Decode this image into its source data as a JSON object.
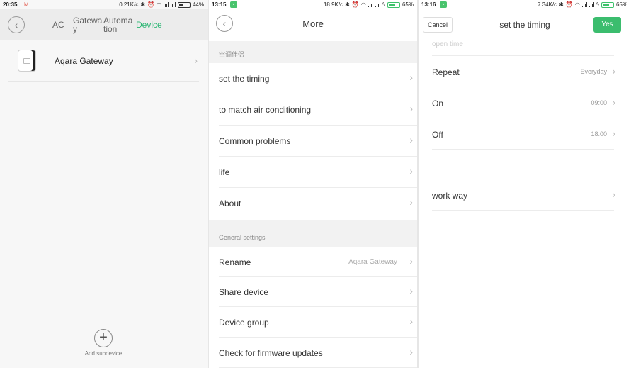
{
  "panel1": {
    "status": {
      "time": "20:35",
      "speed": "0.21K/c",
      "battery": "44%",
      "battery_level": 0.44
    },
    "tabs": [
      "AC",
      "Gatewa\ny",
      "Automa\ntion",
      "Device"
    ],
    "device": {
      "name": "Aqara Gateway"
    },
    "add_subdevice": "Add subdevice"
  },
  "panel2": {
    "status": {
      "time": "13:15",
      "speed": "18.9K/c",
      "battery": "65%",
      "battery_level": 0.65
    },
    "title": "More",
    "section1": "空调伴侣",
    "items1": [
      "set the timing",
      "to match air conditioning",
      "Common problems",
      "life",
      "About"
    ],
    "section2": "General settings",
    "items2": [
      {
        "label": "Rename",
        "value": "Aqara Gateway"
      },
      {
        "label": "Share device",
        "value": ""
      },
      {
        "label": "Device group",
        "value": ""
      },
      {
        "label": "Check for firmware updates",
        "value": ""
      }
    ]
  },
  "panel3": {
    "status": {
      "time": "13:16",
      "speed": "7.34K/c",
      "battery": "65%",
      "battery_level": 0.65
    },
    "cancel": "Cancel",
    "title": "set the timing",
    "yes": "Yes",
    "ghost_item": "open time",
    "rows": [
      {
        "label": "Repeat",
        "value": "Everyday"
      },
      {
        "label": "On",
        "value": "09:00"
      },
      {
        "label": "Off",
        "value": "18:00"
      }
    ],
    "work_way": "work way"
  },
  "colors": {
    "accent": "#2bb673",
    "yes_button": "#3bbd6e"
  }
}
